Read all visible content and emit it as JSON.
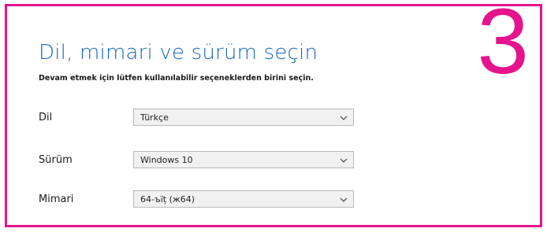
{
  "step": {
    "number": "3"
  },
  "header": {
    "title": "Dil, mimari ve sürüm seçin",
    "subtitle": "Devam etmek için lütfen kullanılabilir seçeneklerden birini seçin."
  },
  "fields": [
    {
      "label": "Dil",
      "value": "Türkçe",
      "icon": "chevron-down-icon"
    },
    {
      "label": "Sürüm",
      "value": "Windows 10",
      "icon": "chevron-down-icon"
    },
    {
      "label": "Mimari",
      "value": "64-ъїț (ж64)",
      "icon": "chevron-down-icon"
    }
  ],
  "colors": {
    "accent": "#e5148c",
    "title": "#1a66c2",
    "select_bg": "#f1f1f1",
    "select_border": "#b9b9b9"
  }
}
